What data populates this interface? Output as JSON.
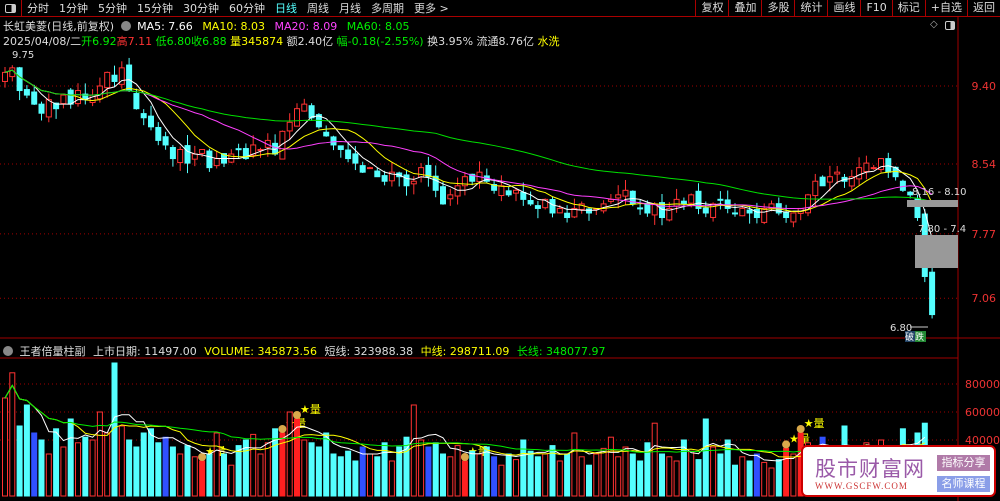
{
  "toolbar": {
    "periods": [
      "分时",
      "1分钟",
      "5分钟",
      "15分钟",
      "30分钟",
      "60分钟",
      "日线",
      "周线",
      "月线",
      "多周期",
      "更多 >"
    ],
    "active": "日线",
    "buttons": [
      "复权",
      "叠加",
      "多股",
      "统计",
      "画线",
      "F10",
      "标记",
      "+自选",
      "返回"
    ]
  },
  "header": {
    "title": "长虹美菱(日线,前复权)",
    "ma5": "MA5: 7.66",
    "ma10": "MA10: 8.03",
    "ma20": "MA20: 8.09",
    "ma60": "MA60: 8.05"
  },
  "quote": {
    "date": "2025/04/08/二",
    "open_l": "开",
    "open": "6.92",
    "high_l": "高",
    "high": "7.11",
    "low_l": "低",
    "low": "6.80",
    "close_l": "收",
    "close": "6.88",
    "vol_l": "量",
    "vol": "345874",
    "amount": "额2.40亿",
    "chg": "幅-0.18(-2.55%)",
    "turnover": "换3.95%",
    "float": "流通8.76亿",
    "tag": "水洗"
  },
  "price_axis": [
    "9.40",
    "8.54",
    "7.77",
    "7.06"
  ],
  "annotations": {
    "high_mark": "9.75",
    "low_mark": "6.80",
    "gap1": "8.16 - 8.10",
    "gap2": "7.80 - 7.4",
    "tag_break": "破",
    "tag_fall": "跌"
  },
  "volume_header": {
    "name": "王者倍量柱副",
    "list_date": "上市日期: 11497.00",
    "volume": "VOLUME: 345873.56",
    "short": "短线: 323988.38",
    "mid": "中线: 298711.09",
    "long": "长线: 348077.97",
    "star_label": "量"
  },
  "volume_axis": [
    "80000",
    "60000",
    "40000"
  ],
  "watermark": {
    "title": "股市财富网",
    "url": "WWW.GSCFW.COM",
    "btn1": "指标分享",
    "btn2": "名师课程"
  },
  "colors": {
    "up": "#ff3232",
    "down": "#54ffff",
    "ma5": "#ffffff",
    "ma10": "#ffff00",
    "ma20": "#ff40ff",
    "ma60": "#00e000",
    "grid": "#a00000"
  },
  "chart_data": {
    "type": "candlestick",
    "closes": [
      9.55,
      9.6,
      9.35,
      9.3,
      9.2,
      9.1,
      9.25,
      9.15,
      9.3,
      9.2,
      9.35,
      9.25,
      9.3,
      9.4,
      9.55,
      9.45,
      9.6,
      9.35,
      9.15,
      9.05,
      8.95,
      8.8,
      8.75,
      8.6,
      8.7,
      8.55,
      8.65,
      8.7,
      8.5,
      8.6,
      8.55,
      8.65,
      8.7,
      8.6,
      8.75,
      8.7,
      8.8,
      8.65,
      8.9,
      9.0,
      9.15,
      9.2,
      9.05,
      8.95,
      8.85,
      8.75,
      8.7,
      8.6,
      8.55,
      8.45,
      8.5,
      8.4,
      8.35,
      8.45,
      8.4,
      8.3,
      8.35,
      8.5,
      8.4,
      8.25,
      8.1,
      8.2,
      8.3,
      8.4,
      8.35,
      8.45,
      8.35,
      8.25,
      8.3,
      8.2,
      8.25,
      8.15,
      8.1,
      8.05,
      8.15,
      8.0,
      8.05,
      7.95,
      8.05,
      8.1,
      8.0,
      8.05,
      8.1,
      8.15,
      8.2,
      8.25,
      8.1,
      8.05,
      8.0,
      8.1,
      7.95,
      8.05,
      8.15,
      8.1,
      8.2,
      8.05,
      8.0,
      8.1,
      8.15,
      8.05,
      8.0,
      8.05,
      8.0,
      7.95,
      8.05,
      8.1,
      8.0,
      7.95,
      8.0,
      8.05,
      8.2,
      8.35,
      8.3,
      8.4,
      8.45,
      8.35,
      8.4,
      8.5,
      8.55,
      8.5,
      8.6,
      8.45,
      8.4,
      8.25,
      8.2,
      7.95,
      7.3,
      6.88
    ],
    "volumes_k": [
      70,
      88,
      50,
      65,
      45,
      40,
      30,
      48,
      35,
      55,
      38,
      42,
      40,
      60,
      45,
      95,
      50,
      40,
      35,
      45,
      48,
      38,
      42,
      35,
      30,
      36,
      28,
      25,
      30,
      45,
      30,
      22,
      36,
      40,
      44,
      30,
      38,
      48,
      45,
      60,
      55,
      40,
      38,
      35,
      45,
      30,
      28,
      32,
      25,
      35,
      30,
      28,
      38,
      25,
      35,
      42,
      65,
      40,
      35,
      38,
      30,
      28,
      36,
      25,
      32,
      30,
      35,
      28,
      22,
      30,
      26,
      40,
      32,
      28,
      30,
      36,
      25,
      30,
      45,
      28,
      22,
      30,
      34,
      42,
      28,
      35,
      30,
      25,
      38,
      52,
      30,
      28,
      25,
      40,
      32,
      26,
      55,
      35,
      30,
      40,
      22,
      28,
      25,
      30,
      24,
      20,
      26,
      34,
      30,
      45,
      38,
      30,
      42,
      25,
      35,
      50,
      28,
      32,
      38,
      30,
      40,
      30,
      35,
      48,
      30,
      45,
      52
    ],
    "star_indices": [
      27,
      38,
      40,
      63,
      107,
      109
    ],
    "price_range": [
      6.7,
      9.85
    ],
    "volume_range": [
      0,
      100000
    ]
  }
}
